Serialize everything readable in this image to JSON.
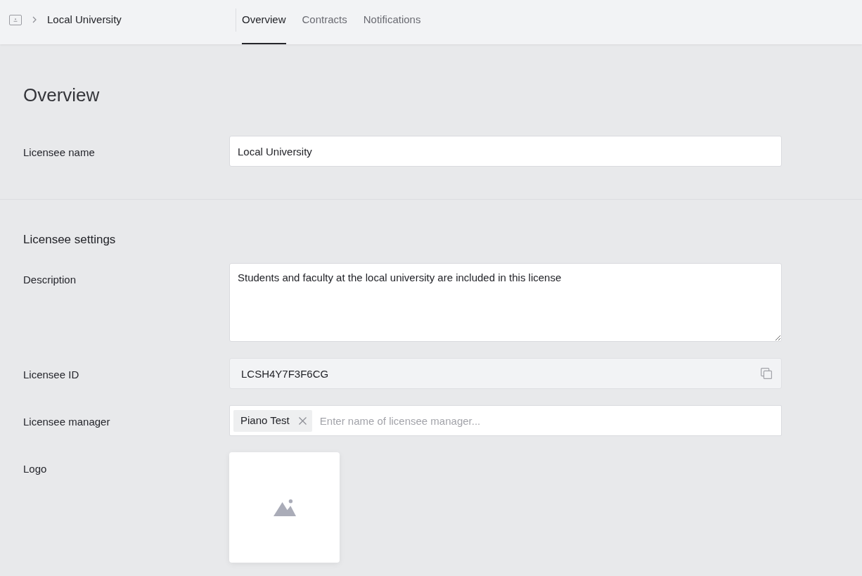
{
  "header": {
    "breadcrumb": "Local University",
    "tabs": [
      {
        "label": "Overview",
        "selected": true
      },
      {
        "label": "Contracts",
        "selected": false
      },
      {
        "label": "Notifications",
        "selected": false
      }
    ]
  },
  "sections": [
    {
      "kind": "page",
      "title": "Overview",
      "fields": [
        {
          "kind": "text",
          "label": "Licensee name",
          "value": "Local University"
        }
      ]
    },
    {
      "kind": "group",
      "title": "Licensee settings",
      "fields": [
        {
          "kind": "textarea",
          "label": "Description",
          "value": "Students and faculty at the local university are included in this license"
        },
        {
          "kind": "readonly",
          "label": "Licensee ID",
          "value": "LCSH4Y7F3F6CG"
        },
        {
          "kind": "tags",
          "label": "Licensee manager",
          "tags": [
            "Piano Test"
          ],
          "placeholder": "Enter name of licensee manager..."
        },
        {
          "kind": "image",
          "label": "Logo"
        }
      ]
    }
  ]
}
